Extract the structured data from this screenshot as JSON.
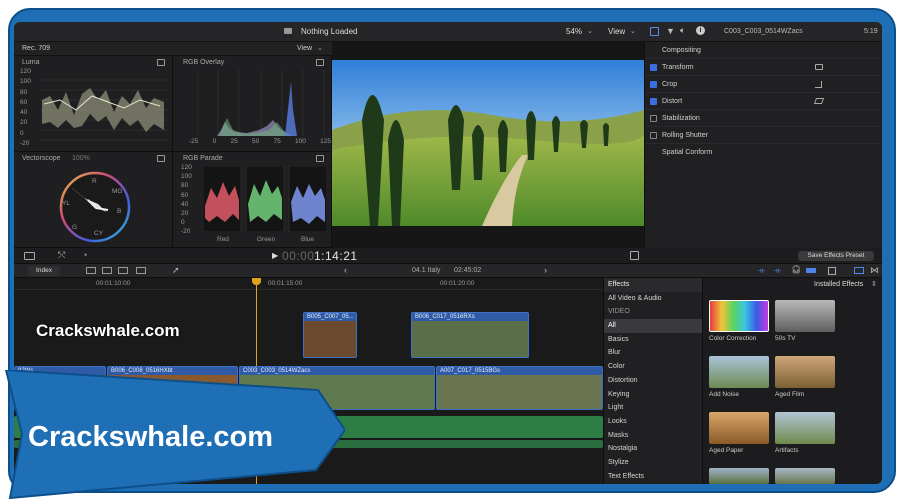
{
  "app": {
    "viewer_title": "Nothing Loaded",
    "zoom": "54%",
    "view_label": "View",
    "view_label_scopes": "View",
    "scope_format": "Rec. 709"
  },
  "scopes": {
    "luma_title": "Luma",
    "luma_ticks": [
      "120",
      "100",
      "80",
      "60",
      "40",
      "20",
      "0",
      "-20"
    ],
    "rgb_overlay_title": "RGB Overlay",
    "rgb_overlay_ticks": [
      "-25",
      "0",
      "25",
      "50",
      "75",
      "100",
      "125"
    ],
    "vectorscope_title": "Vectorscope",
    "vectorscope_pct": "100%",
    "vector_labels": [
      "R",
      "MG",
      "B",
      "CY",
      "G",
      "YL"
    ],
    "rgb_parade_title": "RGB Parade",
    "parade_ticks": [
      "120",
      "100",
      "80",
      "60",
      "40",
      "20",
      "0",
      "-20"
    ],
    "parade_labels": [
      "Red",
      "Green",
      "Blue"
    ]
  },
  "inspector": {
    "clip_name": "C003_C003_0514WZacs",
    "time": "5:19",
    "sections": [
      {
        "label": "Compositing",
        "checkbox": "none"
      },
      {
        "label": "Transform",
        "checkbox": "on"
      },
      {
        "label": "Crop",
        "checkbox": "on"
      },
      {
        "label": "Distort",
        "checkbox": "on"
      },
      {
        "label": "Stabilization",
        "checkbox": "off"
      },
      {
        "label": "Rolling Shutter",
        "checkbox": "off"
      },
      {
        "label": "Spatial Conform",
        "checkbox": "none"
      }
    ],
    "save_preset": "Save Effects Preset"
  },
  "playback": {
    "timecode_dim": "00:00",
    "timecode": "1:14:21"
  },
  "timeline": {
    "index_label": "Index",
    "project": "04.1 Italy",
    "duration": "02:45:02",
    "ruler": [
      "00:01:10:00",
      "00:01:15:00",
      "00:01:20:00"
    ],
    "clips_top": [
      "B005_C007_05...",
      "B006_C017_0516RXs"
    ],
    "clips_main": [
      "92Ws",
      "B006_C008_0516HXbt",
      "C003_C003_0514WZacs",
      "A007_C017_0515BGs"
    ]
  },
  "effects": {
    "header": "Effects",
    "installed": "Installed Effects",
    "categories": [
      "All Video & Audio",
      "VIDEO",
      "All",
      "Basics",
      "Blur",
      "Color",
      "Distortion",
      "Keying",
      "Light",
      "Looks",
      "Masks",
      "Nostalgia",
      "Stylize",
      "Text Effects"
    ],
    "items": [
      "Color Correction",
      "50s TV",
      "Add Noise",
      "Aged Film",
      "Aged Paper",
      "Artifacts"
    ]
  },
  "watermark": {
    "small": "Crackswhale.com",
    "large": "Crackswhale.com"
  },
  "colors": {
    "accent": "#3b6fe0",
    "clip_blue": "#2f5aa6",
    "banner_blue": "#1e6fb5",
    "audio_green": "#2f8a4a",
    "playhead": "#e0a21b"
  }
}
